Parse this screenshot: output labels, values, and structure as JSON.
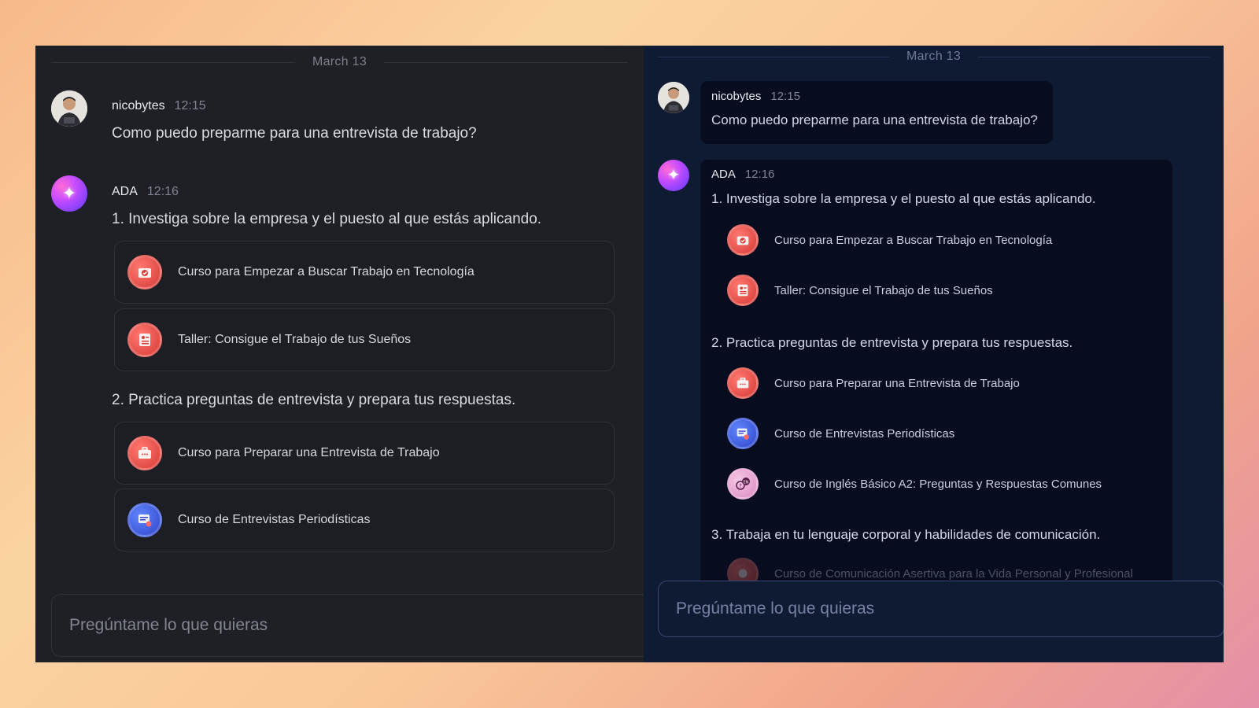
{
  "date_label": "March 13",
  "user": {
    "name": "nicobytes",
    "time": "12:15",
    "message": "Como puedo preparme para una entrevista de trabajo?"
  },
  "assistant": {
    "name": "ADA",
    "time": "12:16"
  },
  "steps": [
    {
      "title": "1. Investiga sobre la empresa y el puesto al que estás aplicando.",
      "courses": [
        {
          "label": "Curso para Empezar a Buscar Trabajo en Tecnología",
          "icon": "job-search-icon"
        },
        {
          "label": "Taller: Consigue el Trabajo de tus Sueños",
          "icon": "resume-icon"
        }
      ]
    },
    {
      "title": "2. Practica preguntas de entrevista y prepara tus respuestas.",
      "courses": [
        {
          "label": "Curso para Preparar una Entrevista de Trabajo",
          "icon": "briefcase-chat-icon"
        },
        {
          "label": "Curso de Entrevistas Periodísticas",
          "icon": "interview-icon"
        },
        {
          "label": "Curso de Inglés Básico A2: Preguntas y Respuestas Comunes",
          "icon": "english-qa-icon"
        }
      ]
    },
    {
      "title": "3. Trabaja en tu lenguaje corporal y habilidades de comunicación.",
      "courses": [
        {
          "label": "Curso de Comunicación Asertiva para la Vida Personal y Profesional",
          "icon": "communication-icon"
        }
      ]
    }
  ],
  "input": {
    "placeholder": "Pregúntame lo que quieras"
  },
  "colors": {
    "left_bg": "#1e2026",
    "right_bg": "#0f1a33",
    "bubble_bg": "#070d1f",
    "course_icon_red": "#e0453f",
    "course_icon_blue": "#3d5ae0"
  }
}
